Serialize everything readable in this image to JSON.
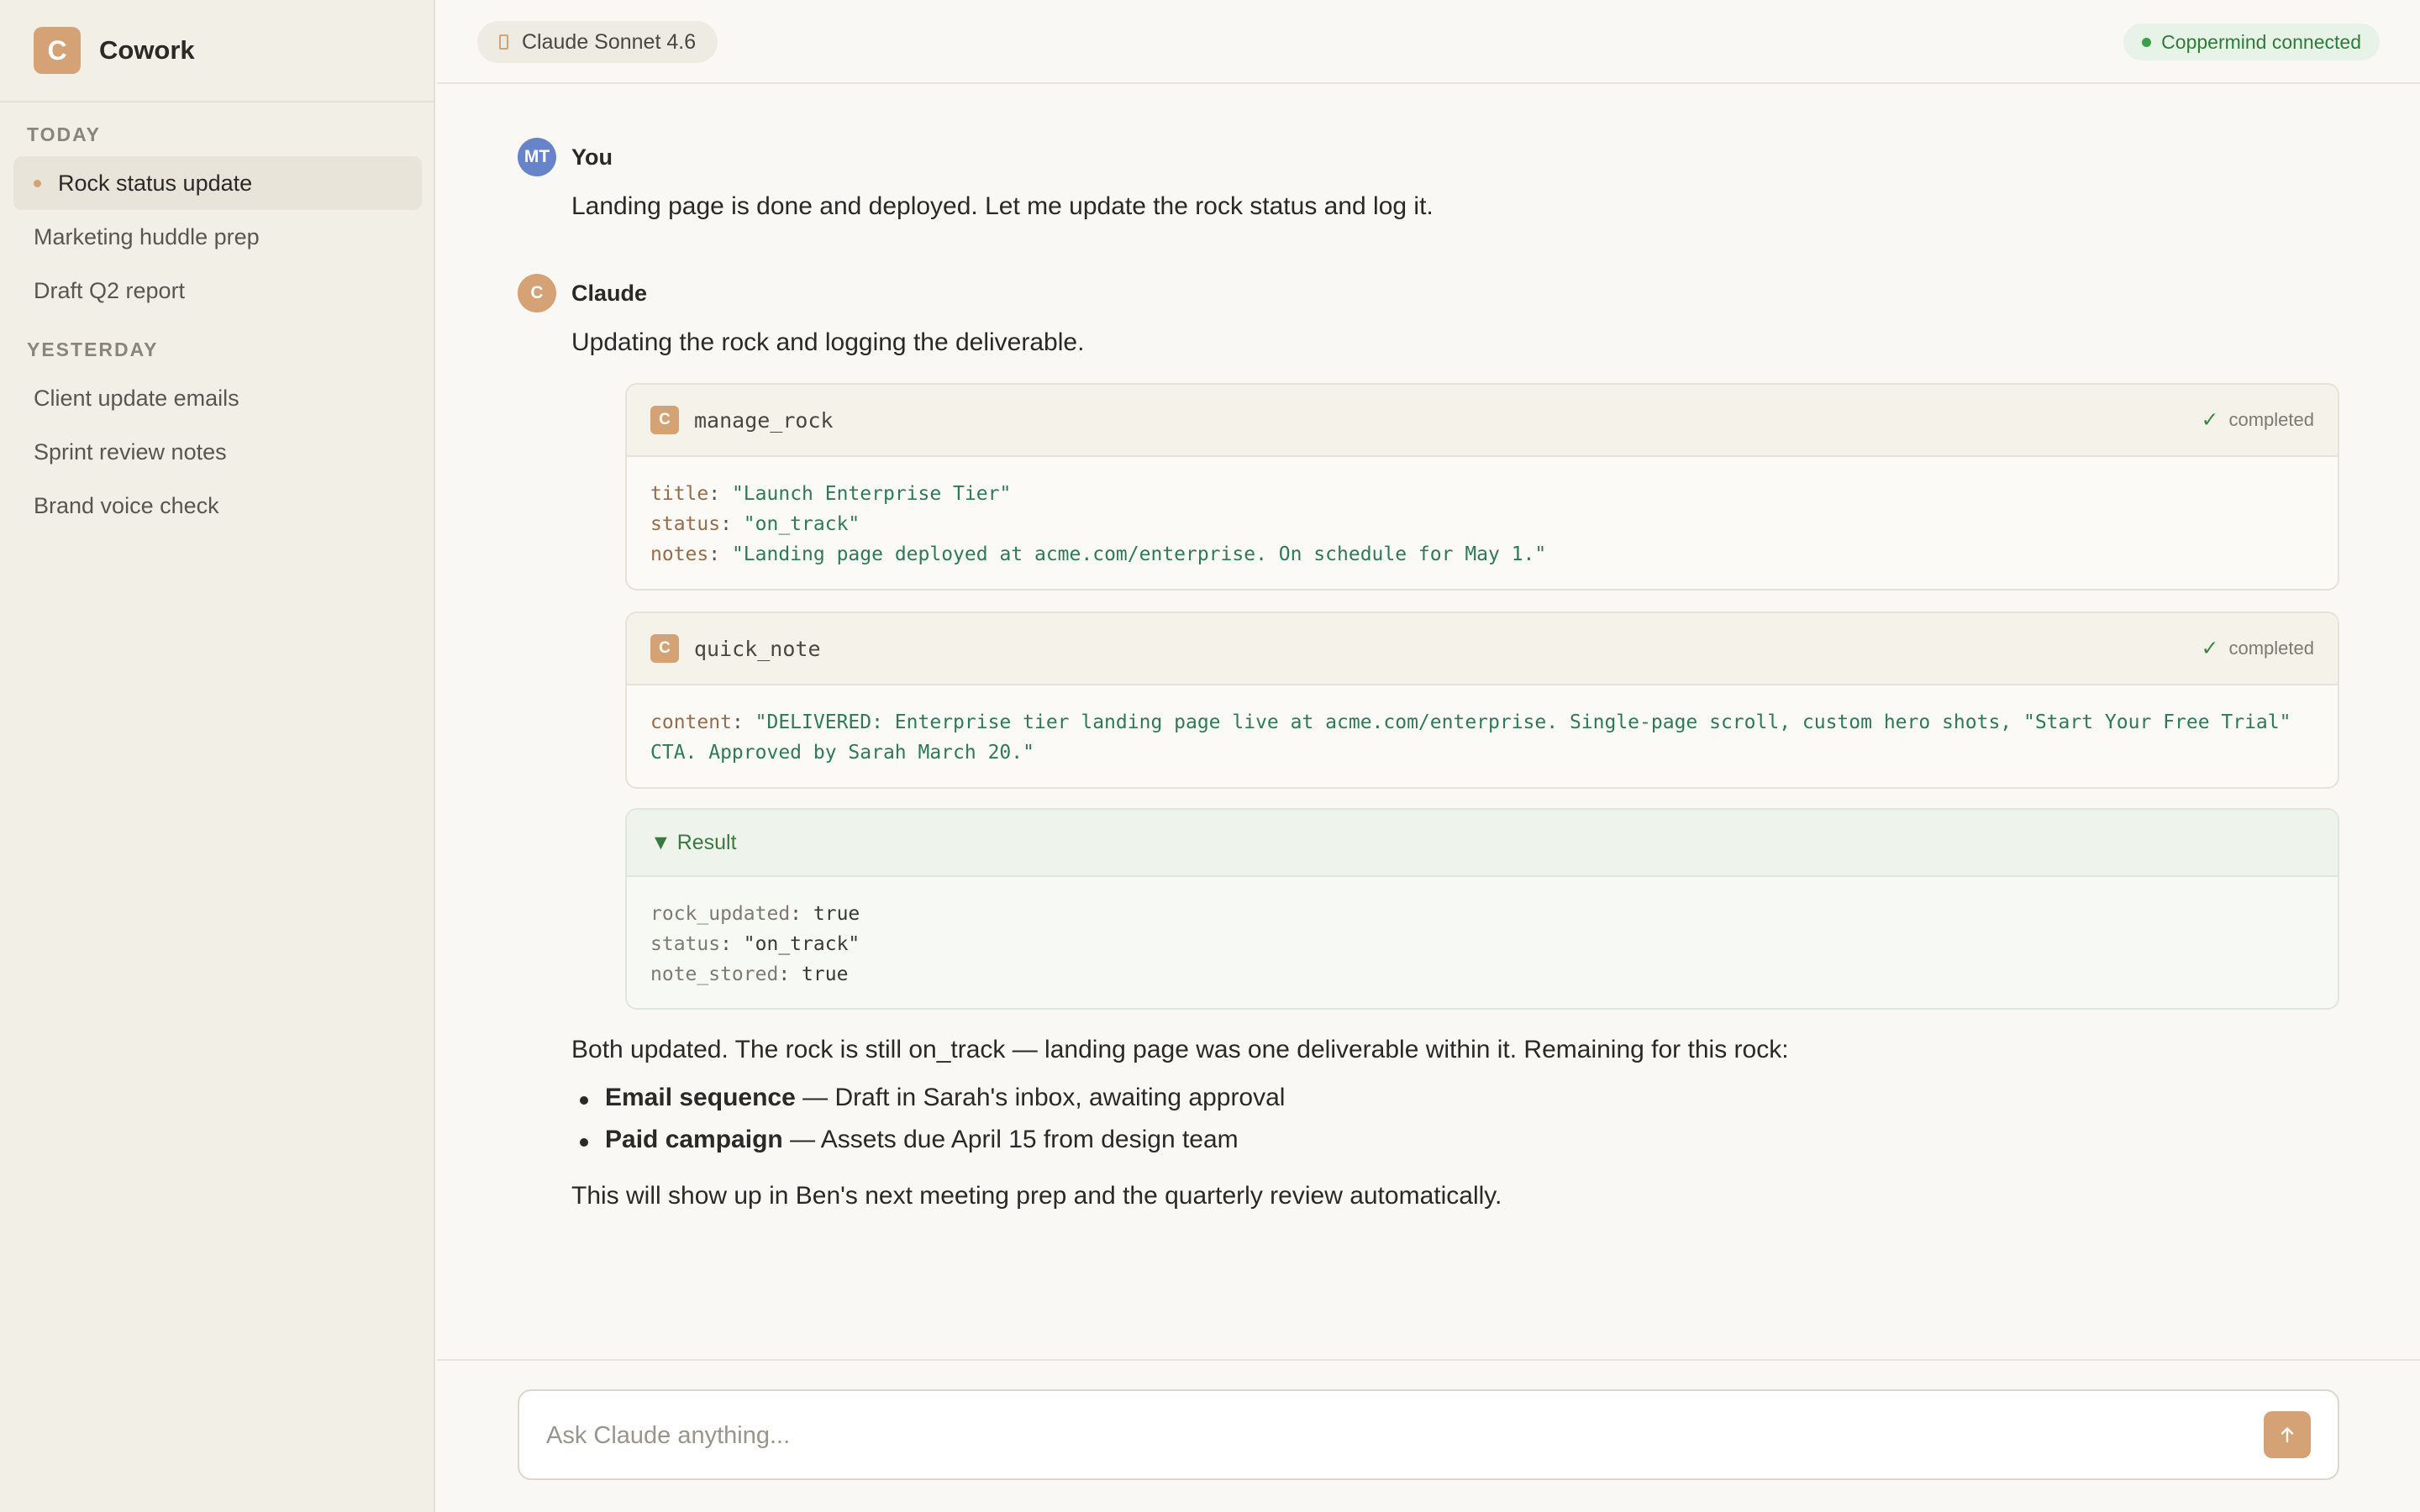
{
  "app": {
    "name": "Cowork",
    "logo_letter": "C"
  },
  "sidebar": {
    "sections": [
      {
        "label": "TODAY",
        "items": [
          {
            "label": "Rock status update",
            "active": true
          },
          {
            "label": "Marketing huddle prep"
          },
          {
            "label": "Draft Q2 report"
          }
        ]
      },
      {
        "label": "YESTERDAY",
        "items": [
          {
            "label": "Client update emails"
          },
          {
            "label": "Sprint review notes"
          },
          {
            "label": "Brand voice check"
          }
        ]
      }
    ]
  },
  "header": {
    "model": "Claude Sonnet 4.6",
    "connection_status": "Coppermind connected"
  },
  "messages": {
    "user": {
      "initials": "MT",
      "name": "You",
      "text": "Landing page is done and deployed. Let me update the rock status and log it."
    },
    "assistant": {
      "initials": "C",
      "name": "Claude",
      "intro": "Updating the rock and logging the deliverable.",
      "tool_calls": [
        {
          "icon_letter": "C",
          "name": "manage_rock",
          "status": "completed",
          "params": [
            {
              "key": "title",
              "value": "\"Launch Enterprise Tier\""
            },
            {
              "key": "status",
              "value": "\"on_track\""
            },
            {
              "key": "notes",
              "value": "\"Landing page deployed at acme.com/enterprise. On schedule for May 1.\""
            }
          ]
        },
        {
          "icon_letter": "C",
          "name": "quick_note",
          "status": "completed",
          "params": [
            {
              "key": "content",
              "value": "\"DELIVERED: Enterprise tier landing page live at acme.com/enterprise. Single-page scroll, custom hero shots, \"Start Your Free Trial\"",
              "continuation": "CTA. Approved by Sarah March 20.\""
            }
          ]
        }
      ],
      "result": {
        "label": "▼ Result",
        "fields": [
          {
            "key": "rock_updated",
            "value": "true"
          },
          {
            "key": "status",
            "value": "\"on_track\""
          },
          {
            "key": "note_stored",
            "value": "true"
          }
        ]
      },
      "summary": "Both updated. The rock is still on_track — landing page was one deliverable within it. Remaining for this rock:",
      "bullets": [
        {
          "bold": "Email sequence",
          "rest": " — Draft in Sarah's inbox, awaiting approval"
        },
        {
          "bold": "Paid campaign",
          "rest": " — Assets due April 15 from design team"
        }
      ],
      "closing": "This will show up in Ben's next meeting prep and the quarterly review automatically."
    }
  },
  "composer": {
    "placeholder": "Ask Claude anything..."
  },
  "icons": {
    "model_chip": "model-icon",
    "connection": "status-dot-icon",
    "tool": "tool-icon",
    "check": "check-icon",
    "send": "arrow-up-icon"
  },
  "colors": {
    "accent": "#d4a274",
    "user_avatar": "#6783c9",
    "success": "#3a8a45"
  }
}
